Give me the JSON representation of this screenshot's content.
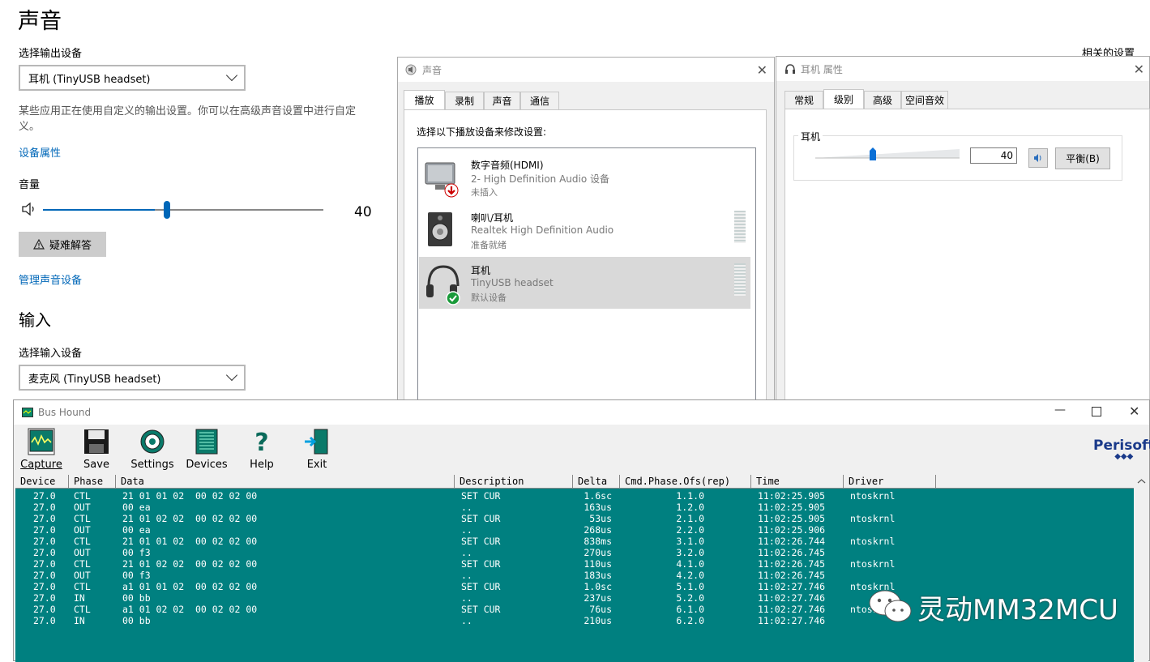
{
  "settings": {
    "title": "声音",
    "output_label": "选择输出设备",
    "output_device": "耳机 (TinyUSB headset)",
    "note_line1": "某些应用正在使用自定义的输出设置。你可以在高级声音设置中进行自定",
    "note_line2": "义。",
    "device_props_link": "设备属性",
    "volume_label": "音量",
    "volume_value": "40",
    "volume_fraction": 0.4,
    "troubleshoot_button": "疑难解答",
    "manage_link": "管理声音设备",
    "input_heading": "输入",
    "input_label": "选择输入设备",
    "input_device": "麦克风 (TinyUSB headset)",
    "related_settings": "相关的设置"
  },
  "sound_dialog": {
    "title": "声音",
    "tabs": [
      "播放",
      "录制",
      "声音",
      "通信"
    ],
    "instruction": "选择以下播放设备来修改设置:",
    "devices": [
      {
        "name": "数字音频(HDMI)",
        "sub": "2- High Definition Audio 设备",
        "status": "未插入"
      },
      {
        "name": "喇叭/耳机",
        "sub": "Realtek High Definition Audio",
        "status": "准备就绪"
      },
      {
        "name": "耳机",
        "sub": "TinyUSB headset",
        "status": "默认设备"
      }
    ]
  },
  "props_dialog": {
    "title": "耳机 属性",
    "tabs": [
      "常规",
      "级别",
      "高级",
      "空间音效"
    ],
    "group_label": "耳机",
    "level_value": "40",
    "level_fraction": 0.4,
    "balance_button": "平衡(B)"
  },
  "bushound": {
    "title": "Bus Hound",
    "tools": [
      "Capture",
      "Save",
      "Settings",
      "Devices",
      "Help",
      "Exit"
    ],
    "logo": "Perisoft",
    "columns": [
      "Device",
      "Phase",
      "Data",
      "Description",
      "Delta",
      "Cmd.Phase.Ofs(rep)",
      "Time",
      "Driver"
    ],
    "rows": [
      [
        "27.0",
        "CTL",
        "21 01 01 02  00 02 02 00",
        "SET CUR",
        "1.6sc",
        "1.1.0",
        "11:02:25.905",
        "ntoskrnl"
      ],
      [
        "27.0",
        "OUT",
        "00 ea",
        "..",
        "163us",
        "1.2.0",
        "11:02:25.905",
        ""
      ],
      [
        "27.0",
        "CTL",
        "21 01 02 02  00 02 02 00",
        "SET CUR",
        "53us",
        "2.1.0",
        "11:02:25.905",
        "ntoskrnl"
      ],
      [
        "27.0",
        "OUT",
        "00 ea",
        "..",
        "268us",
        "2.2.0",
        "11:02:25.906",
        ""
      ],
      [
        "27.0",
        "CTL",
        "21 01 01 02  00 02 02 00",
        "SET CUR",
        "838ms",
        "3.1.0",
        "11:02:26.744",
        "ntoskrnl"
      ],
      [
        "27.0",
        "OUT",
        "00 f3",
        "..",
        "270us",
        "3.2.0",
        "11:02:26.745",
        ""
      ],
      [
        "27.0",
        "CTL",
        "21 01 02 02  00 02 02 00",
        "SET CUR",
        "110us",
        "4.1.0",
        "11:02:26.745",
        "ntoskrnl"
      ],
      [
        "27.0",
        "OUT",
        "00 f3",
        "..",
        "183us",
        "4.2.0",
        "11:02:26.745",
        ""
      ],
      [
        "27.0",
        "CTL",
        "a1 01 01 02  00 02 02 00",
        "SET CUR",
        "1.0sc",
        "5.1.0",
        "11:02:27.746",
        "ntoskrnl"
      ],
      [
        "27.0",
        "IN",
        "00 bb",
        "..",
        "237us",
        "5.2.0",
        "11:02:27.746",
        ""
      ],
      [
        "27.0",
        "CTL",
        "a1 01 02 02  00 02 02 00",
        "SET CUR",
        "76us",
        "6.1.0",
        "11:02:27.746",
        "ntoskrnl"
      ],
      [
        "27.0",
        "IN",
        "00 bb",
        "..",
        "210us",
        "6.2.0",
        "11:02:27.746",
        ""
      ]
    ]
  },
  "watermark": "灵动MM32MCU"
}
